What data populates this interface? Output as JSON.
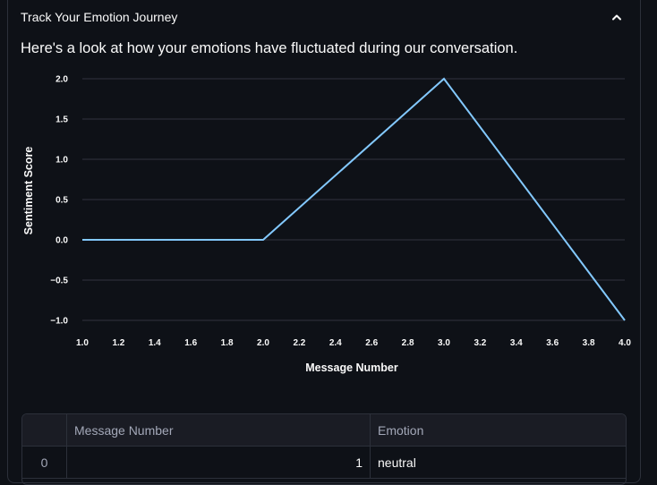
{
  "expander": {
    "title": "Track Your Emotion Journey",
    "expanded": true,
    "chevron_icon": "chevron-up-icon"
  },
  "intro_text": "Here's a look at how your emotions have fluctuated during our conversation.",
  "chart_data": {
    "type": "line",
    "x": [
      1,
      2,
      3,
      4
    ],
    "series": [
      {
        "values": [
          0,
          0,
          2,
          -1
        ]
      }
    ],
    "xlabel": "Message Number",
    "ylabel": "Sentiment Score",
    "xlim": [
      1.0,
      4.0
    ],
    "ylim": [
      -1.0,
      2.0
    ],
    "x_ticks": [
      "1.0",
      "1.2",
      "1.4",
      "1.6",
      "1.8",
      "2.0",
      "2.2",
      "2.4",
      "2.6",
      "2.8",
      "3.0",
      "3.2",
      "3.4",
      "3.6",
      "3.8",
      "4.0"
    ],
    "y_ticks": [
      "2.0",
      "1.5",
      "1.0",
      "0.5",
      "0.0",
      "−0.5",
      "−1.0"
    ],
    "line_color": "#83c9ff",
    "grid": true
  },
  "table": {
    "columns": [
      "",
      "Message Number",
      "Emotion"
    ],
    "rows": [
      {
        "index": "0",
        "message_number": "1",
        "emotion": "neutral"
      }
    ]
  }
}
